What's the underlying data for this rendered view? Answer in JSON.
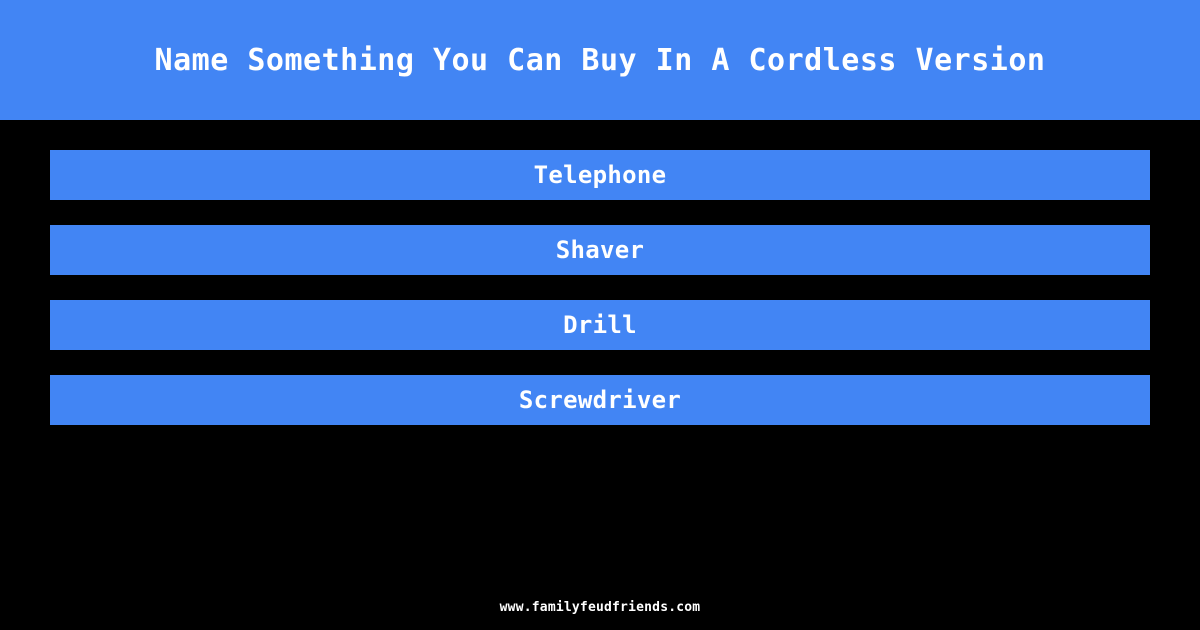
{
  "header": {
    "title": "Name Something You Can Buy In A Cordless Version",
    "background_color": "#4285f4",
    "text_color": "#ffffff"
  },
  "board": {
    "background_color": "#000000",
    "answer_bar_color": "#4285f4",
    "answer_text_color": "#ffffff",
    "answers": [
      {
        "rank": 1,
        "text": "Telephone"
      },
      {
        "rank": 2,
        "text": "Shaver"
      },
      {
        "rank": 3,
        "text": "Drill"
      },
      {
        "rank": 4,
        "text": "Screwdriver"
      }
    ]
  },
  "footer": {
    "url": "www.familyfeudfriends.com",
    "text_color": "#ffffff"
  }
}
